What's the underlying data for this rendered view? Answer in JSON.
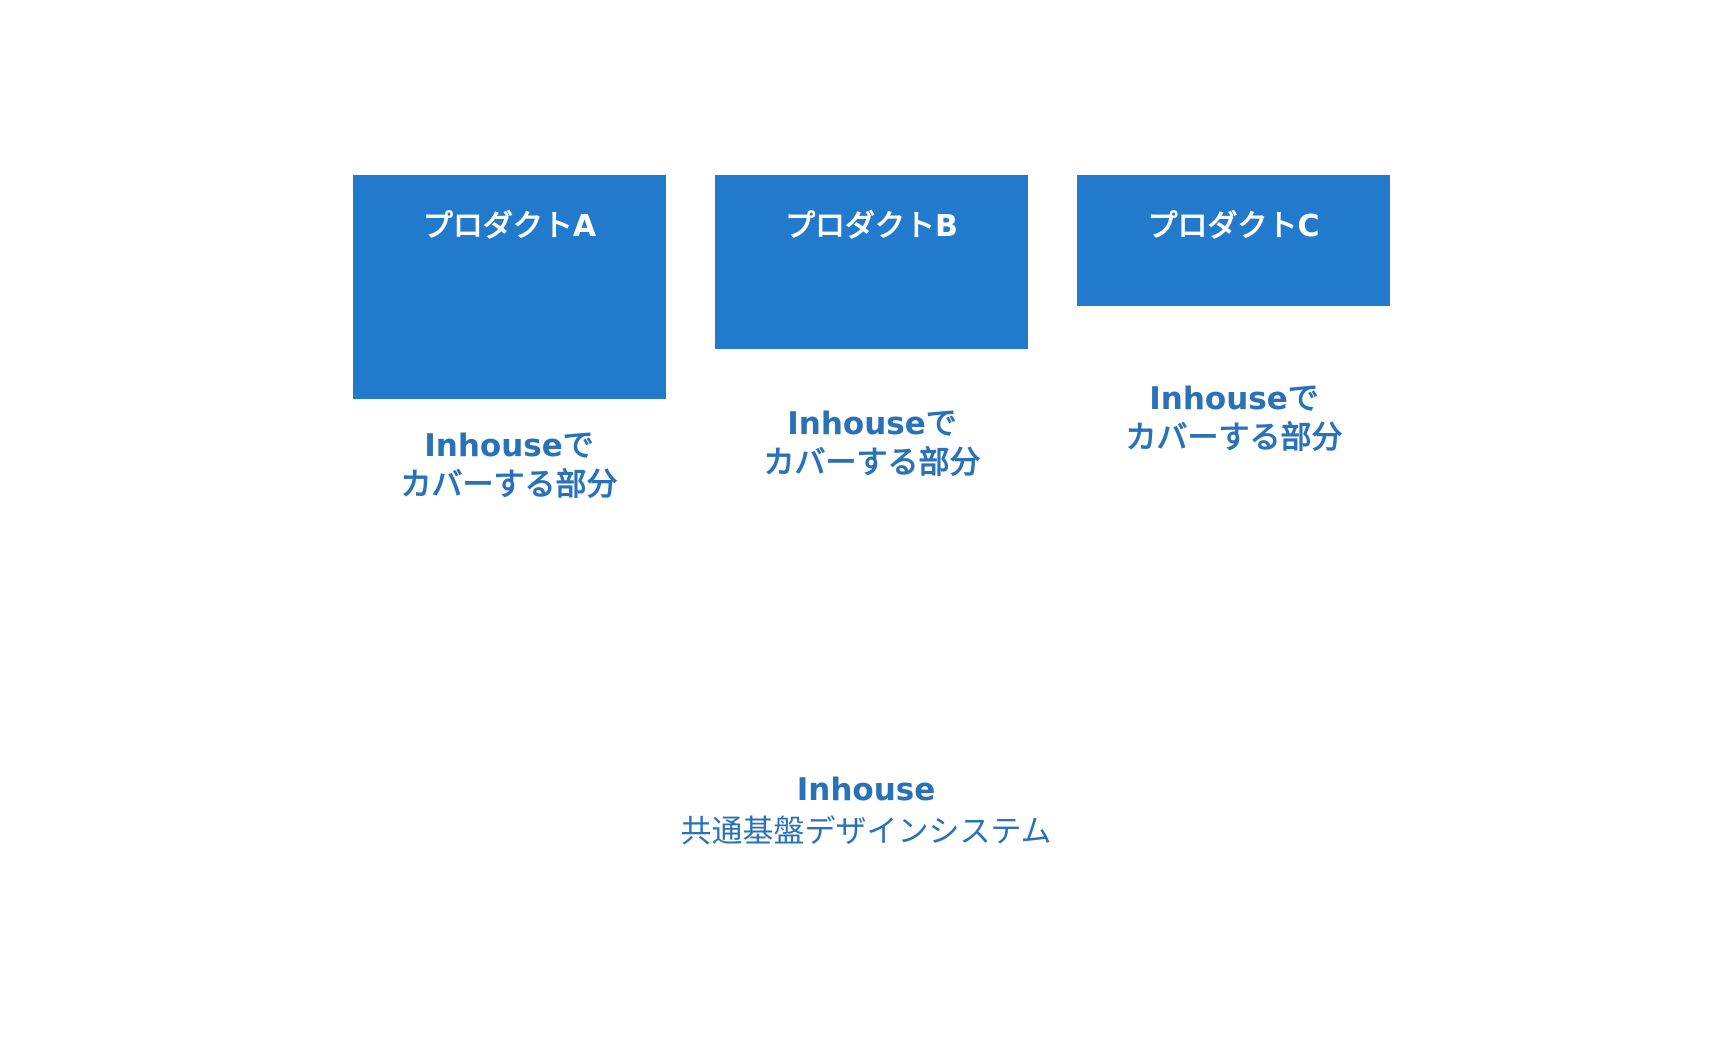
{
  "products": [
    {
      "title": "プロダクトA",
      "coverage_line1": "Inhouseで",
      "coverage_line2": "カバーする部分"
    },
    {
      "title": "プロダクトB",
      "coverage_line1": "Inhouseで",
      "coverage_line2": "カバーする部分"
    },
    {
      "title": "プロダクトC",
      "coverage_line1": "Inhouseで",
      "coverage_line2": "カバーする部分"
    }
  ],
  "foundation": {
    "name": "Inhouse",
    "description": "共通基盤デザインシステム"
  },
  "colors": {
    "box_fill": "#217acc",
    "text_accent": "#2a72b8",
    "box_text": "#ffffff"
  }
}
